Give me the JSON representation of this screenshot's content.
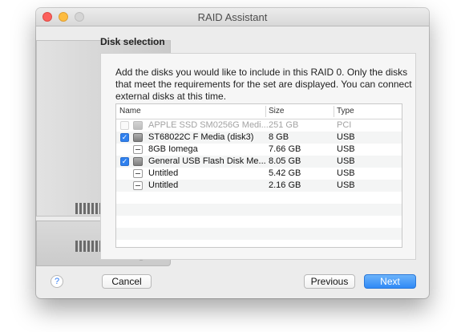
{
  "window": {
    "title": "RAID Assistant"
  },
  "section": {
    "title": "Disk selection"
  },
  "description": "Add the disks you would like to include in this RAID 0. Only the disks that meet the requirements for the set are displayed. You can connect external disks at this time.",
  "table": {
    "headers": [
      "Name",
      "Size",
      "Type"
    ],
    "rows": [
      {
        "name": "APPLE SSD SM0256G Medi...",
        "size": "251 GB",
        "type": "PCI",
        "checkbox": "unchecked",
        "icon": "drive-icon",
        "enabled": false
      },
      {
        "name": "ST68022C F Media (disk3)",
        "size": "8 GB",
        "type": "USB",
        "checkbox": "checked",
        "icon": "drive-icon",
        "enabled": true
      },
      {
        "name": "8GB Iomega",
        "size": "7.66 GB",
        "type": "USB",
        "checkbox": "none",
        "icon": "volume-icon",
        "enabled": true
      },
      {
        "name": "General USB Flash Disk Me...",
        "size": "8.05 GB",
        "type": "USB",
        "checkbox": "checked",
        "icon": "drive-icon",
        "enabled": true
      },
      {
        "name": "Untitled",
        "size": "5.42 GB",
        "type": "USB",
        "checkbox": "none",
        "icon": "volume-icon",
        "enabled": true
      },
      {
        "name": "Untitled",
        "size": "2.16 GB",
        "type": "USB",
        "checkbox": "none",
        "icon": "volume-icon",
        "enabled": true
      }
    ]
  },
  "buttons": {
    "help": "?",
    "cancel": "Cancel",
    "previous": "Previous",
    "next": "Next"
  },
  "colors": {
    "accent": "#2f89f6",
    "close": "#fc605c",
    "minimize": "#fdbc40"
  },
  "checkbox_glyph": "✓"
}
